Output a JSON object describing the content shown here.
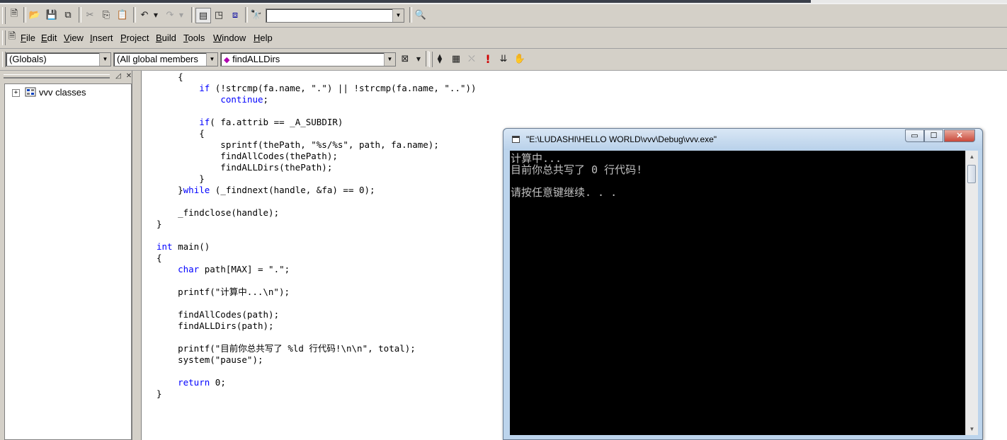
{
  "toolbar": {
    "find_combo_value": "",
    "icons": [
      "new-text-file-icon",
      "open-folder-icon",
      "save-icon",
      "save-all-icon",
      "cut-icon",
      "copy-icon",
      "paste-icon",
      "undo-icon",
      "redo-icon",
      "workspace-icon",
      "output-icon",
      "window-list-icon",
      "find-in-files-icon",
      "search-icon"
    ]
  },
  "menu": {
    "items": [
      {
        "label": "File",
        "accel": "F",
        "rest": "ile"
      },
      {
        "label": "Edit",
        "accel": "E",
        "rest": "dit"
      },
      {
        "label": "View",
        "accel": "V",
        "rest": "iew"
      },
      {
        "label": "Insert",
        "accel": "I",
        "rest": "nsert"
      },
      {
        "label": "Project",
        "accel": "P",
        "rest": "roject"
      },
      {
        "label": "Build",
        "accel": "B",
        "rest": "uild"
      },
      {
        "label": "Tools",
        "accel": "T",
        "rest": "ools"
      },
      {
        "label": "Window",
        "accel": "W",
        "rest": "indow"
      },
      {
        "label": "Help",
        "accel": "H",
        "rest": "elp"
      }
    ]
  },
  "wizardbar": {
    "class_combo": "(Globals)",
    "filter_combo": "(All global members",
    "member_combo": "findALLDirs"
  },
  "classview": {
    "root_label": "vvv classes"
  },
  "editor": {
    "lines": [
      [
        {
          "t": "    {"
        }
      ],
      [
        {
          "t": "        "
        },
        {
          "t": "if",
          "kw": true
        },
        {
          "t": " (!strcmp(fa.name, \".\") || !strcmp(fa.name, \"..\"))"
        }
      ],
      [
        {
          "t": "            "
        },
        {
          "t": "continue",
          "kw": true
        },
        {
          "t": ";"
        }
      ],
      [
        {
          "t": ""
        }
      ],
      [
        {
          "t": "        "
        },
        {
          "t": "if",
          "kw": true
        },
        {
          "t": "( fa.attrib == _A_SUBDIR)"
        }
      ],
      [
        {
          "t": "        {"
        }
      ],
      [
        {
          "t": "            sprintf(thePath, \"%s/%s\", path, fa.name);"
        }
      ],
      [
        {
          "t": "            findAllCodes(thePath);"
        }
      ],
      [
        {
          "t": "            findALLDirs(thePath);"
        }
      ],
      [
        {
          "t": "        }"
        }
      ],
      [
        {
          "t": "    }"
        },
        {
          "t": "while",
          "kw": true
        },
        {
          "t": " (_findnext(handle, &fa) == 0);"
        }
      ],
      [
        {
          "t": ""
        }
      ],
      [
        {
          "t": "    _findclose(handle);"
        }
      ],
      [
        {
          "t": "}"
        }
      ],
      [
        {
          "t": ""
        }
      ],
      [
        {
          "t": "int",
          "kw": true
        },
        {
          "t": " main()"
        }
      ],
      [
        {
          "t": "{"
        }
      ],
      [
        {
          "t": "    "
        },
        {
          "t": "char",
          "kw": true
        },
        {
          "t": " path[MAX] = \".\";"
        }
      ],
      [
        {
          "t": ""
        }
      ],
      [
        {
          "t": "    printf(\"计算中...\\n\");"
        }
      ],
      [
        {
          "t": ""
        }
      ],
      [
        {
          "t": "    findAllCodes(path);"
        }
      ],
      [
        {
          "t": "    findALLDirs(path);"
        }
      ],
      [
        {
          "t": ""
        }
      ],
      [
        {
          "t": "    printf(\"目前你总共写了 %ld 行代码!\\n\\n\", total);"
        }
      ],
      [
        {
          "t": "    system(\"pause\");"
        }
      ],
      [
        {
          "t": ""
        }
      ],
      [
        {
          "t": "    "
        },
        {
          "t": "return",
          "kw": true
        },
        {
          "t": " 0;"
        }
      ],
      [
        {
          "t": "}"
        }
      ]
    ]
  },
  "console": {
    "title": "\"E:\\LUDASHI\\HELLO WORLD\\vvv\\Debug\\vvv.exe\"",
    "lines": [
      "计算中...",
      "目前你总共写了 0 行代码!",
      "",
      "请按任意键继续. . ."
    ],
    "minimize_glyph": "▭",
    "maximize_glyph": "☐",
    "close_glyph": "✕"
  }
}
